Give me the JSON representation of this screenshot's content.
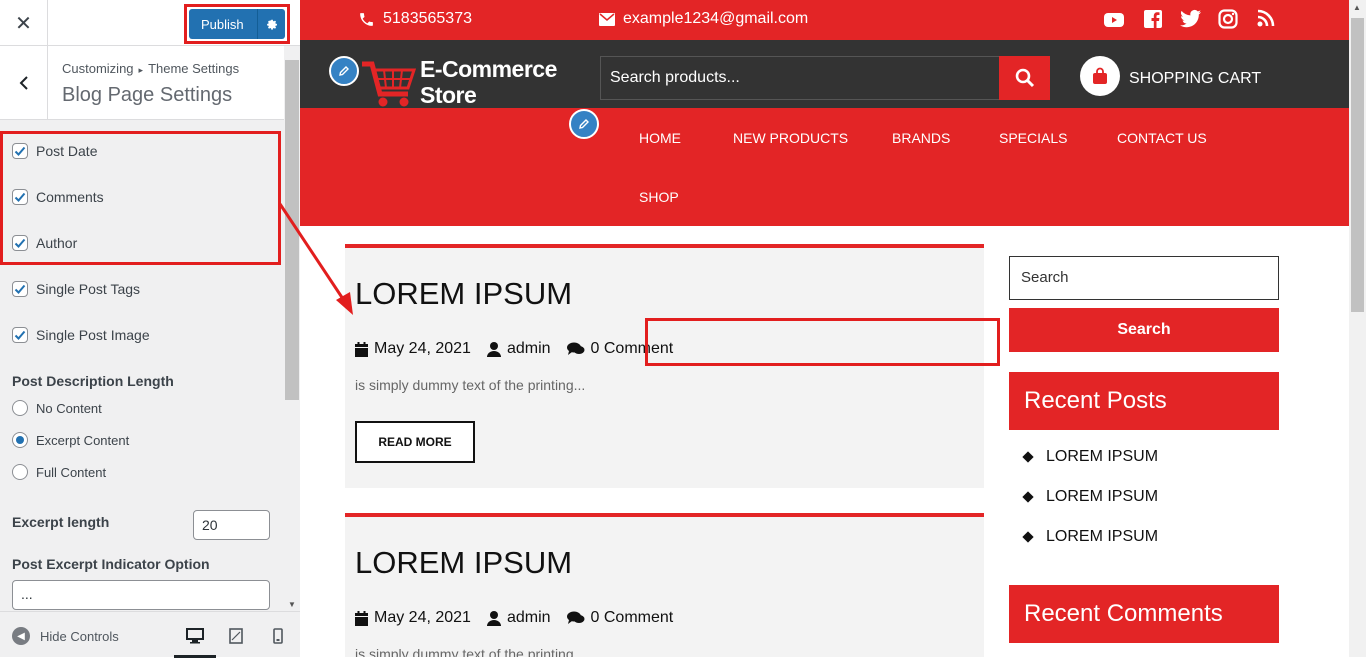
{
  "customizer": {
    "publish_label": "Publish",
    "breadcrumb_root": "Customizing",
    "breadcrumb_sep": "▸",
    "breadcrumb_parent": "Theme Settings",
    "section_title": "Blog Page Settings",
    "checkboxes": [
      {
        "label": "Post Date",
        "checked": true
      },
      {
        "label": "Comments",
        "checked": true
      },
      {
        "label": "Author",
        "checked": true
      },
      {
        "label": "Single Post Tags",
        "checked": true
      },
      {
        "label": "Single Post Image",
        "checked": true
      }
    ],
    "desc_length_label": "Post Description Length",
    "desc_length_options": [
      {
        "label": "No Content",
        "selected": false
      },
      {
        "label": "Excerpt Content",
        "selected": true
      },
      {
        "label": "Full Content",
        "selected": false
      }
    ],
    "excerpt_length_label": "Excerpt length",
    "excerpt_length_value": "20",
    "indicator_label": "Post Excerpt Indicator Option",
    "indicator_value": "...",
    "hide_controls_label": "Hide Controls"
  },
  "site": {
    "phone": "5183565373",
    "email": "example1234@gmail.com",
    "social_icons": [
      "youtube-icon",
      "facebook-icon",
      "twitter-icon",
      "instagram-icon",
      "rss-icon"
    ],
    "logo_line1": "E-Commerce",
    "logo_line2": "Store",
    "search_placeholder": "Search products...",
    "cart_label": "SHOPPING CART",
    "nav": [
      "HOME",
      "NEW PRODUCTS",
      "BRANDS",
      "SPECIALS",
      "CONTACT US",
      "SHOP"
    ],
    "posts": [
      {
        "title": "LOREM IPSUM",
        "date": "May 24, 2021",
        "author": "admin",
        "comments": "0 Comment",
        "excerpt": "is simply dummy text of the printing...",
        "read_more": "READ MORE"
      },
      {
        "title": "LOREM IPSUM",
        "date": "May 24, 2021",
        "author": "admin",
        "comments": "0 Comment",
        "excerpt": "is simply dummy text of the printing..."
      }
    ],
    "sidebar": {
      "search_placeholder": "Search",
      "search_button": "Search",
      "recent_posts_title": "Recent Posts",
      "recent_posts": [
        "LOREM IPSUM",
        "LOREM IPSUM",
        "LOREM IPSUM"
      ],
      "recent_comments_title": "Recent Comments"
    }
  },
  "colors": {
    "brand_red": "#e32526",
    "header_dark": "#333333",
    "wp_blue": "#2271b1",
    "annotation_red": "#e21e1e"
  }
}
